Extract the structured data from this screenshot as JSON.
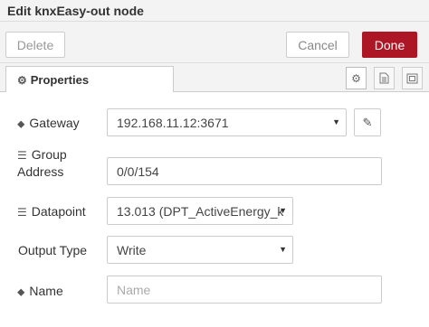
{
  "dialog": {
    "title": "Edit knxEasy-out node"
  },
  "toolbar": {
    "delete_label": "Delete",
    "cancel_label": "Cancel",
    "done_label": "Done"
  },
  "tabs": {
    "properties_label": "Properties"
  },
  "icons": {
    "tab_gear": "gear-icon",
    "tab_1": "gear-icon",
    "tab_2": "document-icon",
    "tab_3": "frame-icon",
    "edit": "pencil-icon"
  },
  "colors": {
    "done_bg": "#ad1625"
  },
  "form": {
    "gateway_label": "Gateway",
    "gateway_value": "192.168.11.12:3671",
    "group_label_line1": "Group",
    "group_label_line2": "Address",
    "group_value": "0/0/154",
    "datapoint_label": "Datapoint",
    "datapoint_value": "13.013 (DPT_ActiveEnergy_k",
    "output_type_label": "Output Type",
    "output_type_value": "Write",
    "name_label": "Name",
    "name_placeholder": "Name"
  }
}
